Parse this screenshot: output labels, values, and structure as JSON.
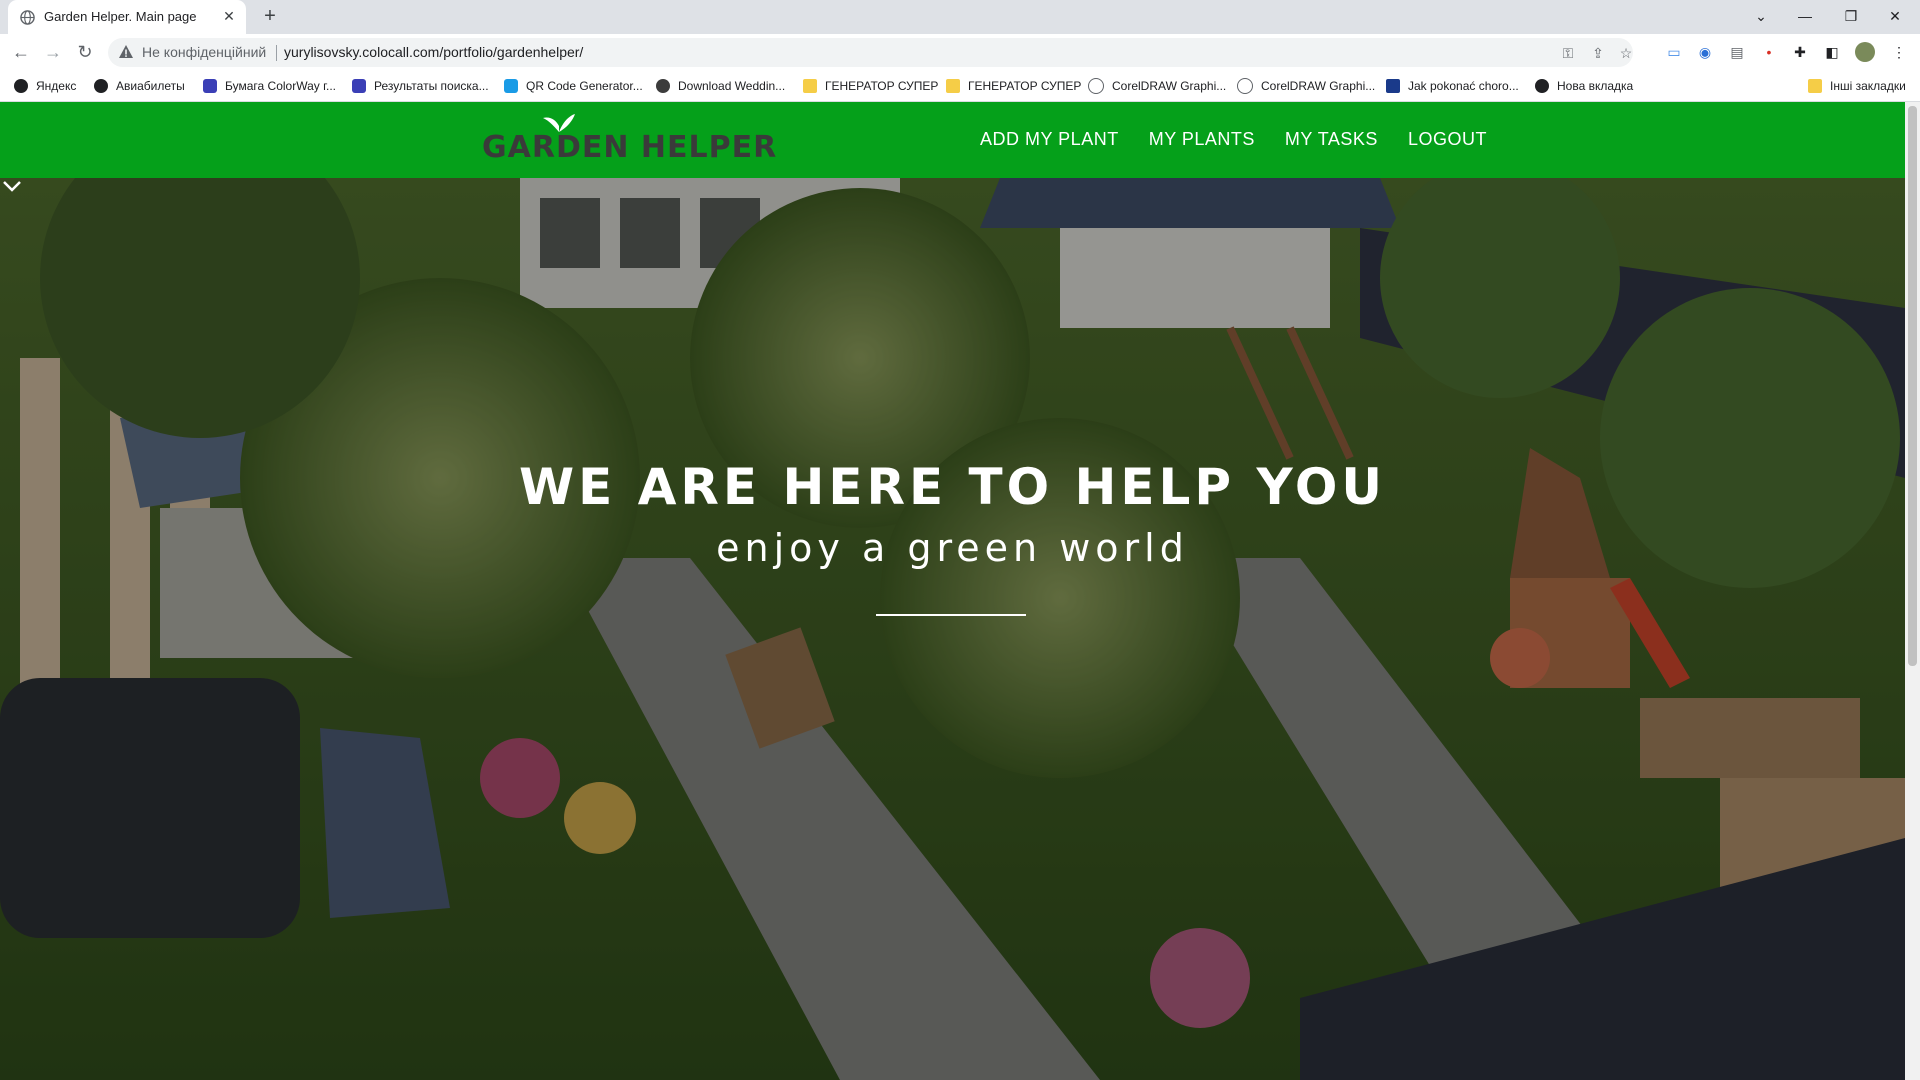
{
  "browser": {
    "tab_title": "Garden Helper. Main page",
    "security_label": "Не конфіденційний",
    "url": "yurylisovsky.colocall.com/portfolio/gardenhelper/",
    "bookmarks": [
      {
        "label": "Яндекс",
        "icon": "globe-icon"
      },
      {
        "label": "Авиабилеты",
        "icon": "globe-icon"
      },
      {
        "label": "Бумага ColorWay г...",
        "icon": "colorway-icon"
      },
      {
        "label": "Результаты поиска...",
        "icon": "colorway-icon"
      },
      {
        "label": "QR Code Generator...",
        "icon": "qr-icon"
      },
      {
        "label": "Download Weddin...",
        "icon": "star-badge-icon"
      },
      {
        "label": "ГЕНЕРАТОР СУПЕР",
        "icon": "folder-icon"
      },
      {
        "label": "ГЕНЕРАТОР СУПЕР",
        "icon": "folder-icon"
      },
      {
        "label": "CorelDRAW Graphi...",
        "icon": "star-outline-icon"
      },
      {
        "label": "CorelDRAW Graphi...",
        "icon": "star-outline-icon"
      },
      {
        "label": "Jak pokonać choro...",
        "icon": "anchor-icon"
      },
      {
        "label": "Нова вкладка",
        "icon": "globe-icon"
      }
    ],
    "other_bookmarks": "Інші закладки"
  },
  "site": {
    "brand_color": "#05a01a",
    "logo_text": "GARDEN HELPER",
    "nav": [
      "ADD MY PLANT",
      "MY PLANTS",
      "MY TASKS",
      "LOGOUT"
    ],
    "hero_title": "WE ARE HERE TO HELP YOU",
    "hero_subtitle": "enjoy a green world"
  }
}
